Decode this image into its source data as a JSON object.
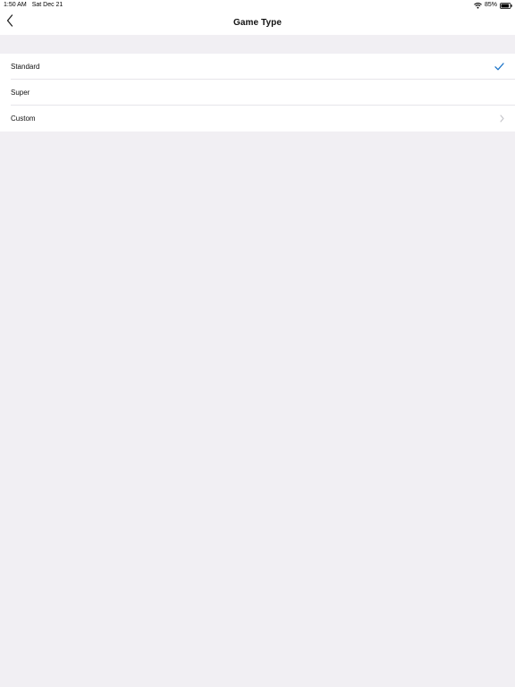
{
  "status_bar": {
    "time": "1:50 AM",
    "date": "Sat Dec 21",
    "battery": "85%",
    "wifi_icon": "wifi-icon",
    "battery_icon": "battery-icon"
  },
  "nav": {
    "title": "Game Type",
    "back_icon": "chevron-left-icon"
  },
  "options": [
    {
      "label": "Standard",
      "trailing": "checkmark-icon",
      "selected": true
    },
    {
      "label": "Super",
      "trailing": "",
      "selected": false
    },
    {
      "label": "Custom",
      "trailing": "chevron-right-icon",
      "selected": false
    }
  ],
  "colors": {
    "accent": "#1a73c8",
    "background": "#f1eff3",
    "surface": "#ffffff",
    "chevron": "#c4c4c9"
  }
}
